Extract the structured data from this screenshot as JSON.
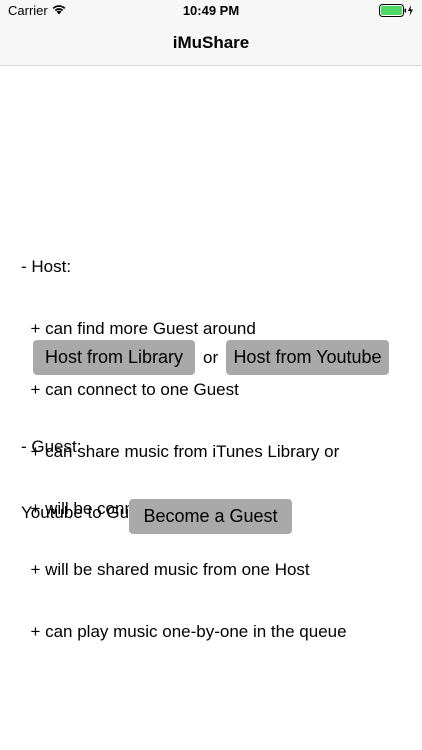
{
  "status_bar": {
    "carrier": "Carrier",
    "time": "10:49 PM",
    "battery_color": "#4cd964",
    "icons": [
      "wifi-icon",
      "battery-icon",
      "charging-icon"
    ]
  },
  "nav": {
    "title": "iMuShare"
  },
  "host": {
    "lines": [
      "- Host:",
      "  + can find more Guest around",
      "  + can connect to one Guest",
      "  + can share music from iTunes Library or",
      "Youtube to Guest"
    ]
  },
  "buttons": {
    "host_library": "Host from Library",
    "or": "or",
    "host_youtube": "Host from Youtube",
    "become_guest": "Become a Guest"
  },
  "guest": {
    "lines": [
      "- Guest:",
      "  + will be connected from one Host",
      "  + will be shared music from one Host",
      "  + can play music one-by-one in the queue"
    ]
  },
  "colors": {
    "button_bg": "#a9a9a9",
    "nav_bg": "#f7f7f7"
  }
}
